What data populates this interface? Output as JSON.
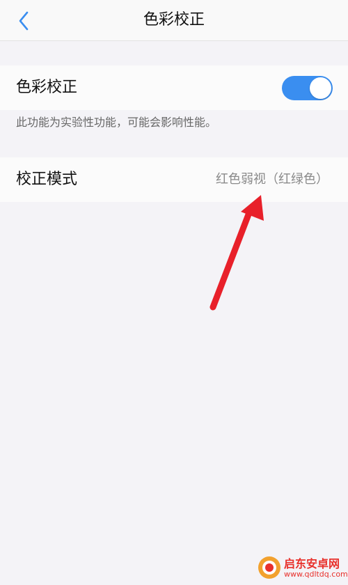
{
  "nav": {
    "title": "色彩校正",
    "back_icon": "chevron-left-icon"
  },
  "color_correction": {
    "label": "色彩校正",
    "enabled": true,
    "hint": "此功能为实验性功能，可能会影响性能。"
  },
  "correction_mode": {
    "label": "校正模式",
    "value": "红色弱视（红绿色）"
  },
  "watermark": {
    "name": "启东安卓网",
    "url": "www.qdltdq.com"
  },
  "colors": {
    "accent": "#3a8ef0",
    "annotation_arrow": "#e8202a",
    "watermark": "#e8302b"
  }
}
